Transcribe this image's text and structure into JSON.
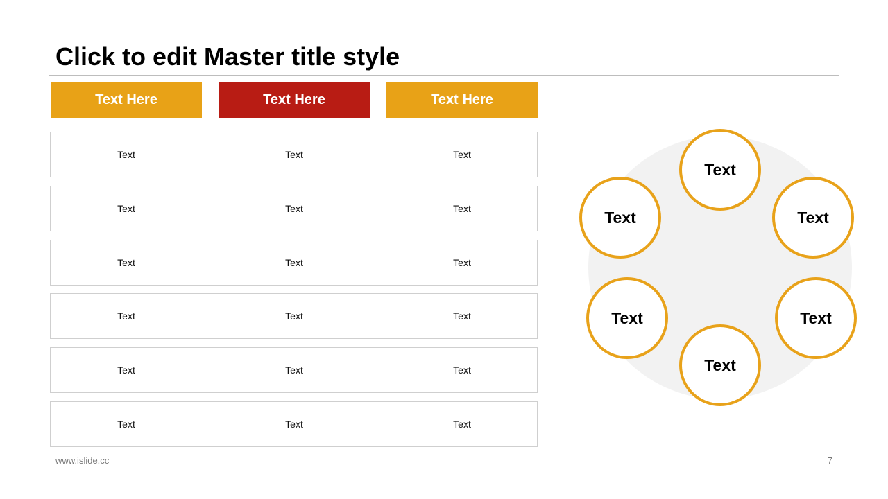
{
  "slide": {
    "title": "Click to edit Master title style",
    "footer_url": "www.islide.cc",
    "page_number": "7"
  },
  "colors": {
    "accent_orange": "#E8A217",
    "accent_red": "#B81C14",
    "node_border": "#E8A21A",
    "row_border": "#CFCFCF"
  },
  "table": {
    "headers": [
      {
        "label": "Text Here",
        "color": "#E8A217"
      },
      {
        "label": "Text Here",
        "color": "#B81C14"
      },
      {
        "label": "Text Here",
        "color": "#E8A217"
      }
    ],
    "rows": [
      [
        "Text",
        "Text",
        "Text"
      ],
      [
        "Text",
        "Text",
        "Text"
      ],
      [
        "Text",
        "Text",
        "Text"
      ],
      [
        "Text",
        "Text",
        "Text"
      ],
      [
        "Text",
        "Text",
        "Text"
      ],
      [
        "Text",
        "Text",
        "Text"
      ]
    ]
  },
  "cycle": {
    "nodes": [
      {
        "label": "Text"
      },
      {
        "label": "Text"
      },
      {
        "label": "Text"
      },
      {
        "label": "Text"
      },
      {
        "label": "Text"
      },
      {
        "label": "Text"
      }
    ]
  }
}
